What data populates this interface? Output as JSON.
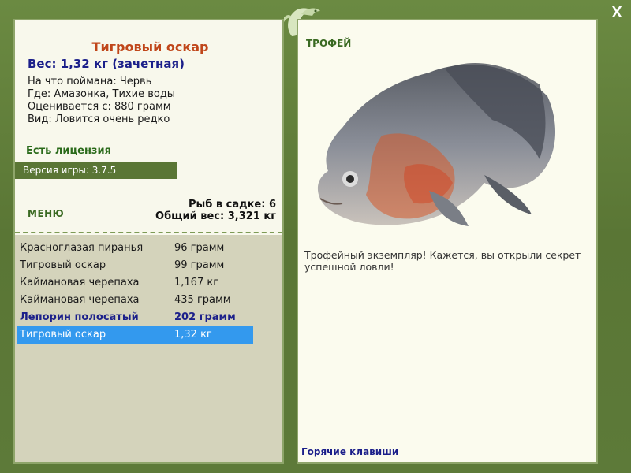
{
  "window": {
    "close_label": "X"
  },
  "fish": {
    "name": "Тигровый оскар",
    "weight": "Вес: 1,32 кг (зачетная)",
    "bait": "На что поймана: Червь",
    "location": "Где: Амазонка, Тихие воды",
    "value": "Оценивается с: 880 грамм",
    "rarity": "Вид: Ловится очень редко"
  },
  "license": "Есть лицензия",
  "version": "Версия игры: 3.7.5",
  "menu_label": "МЕНЮ",
  "cage": {
    "count": "Рыб в садке: 6",
    "total": "Общий вес: 3,321 кг"
  },
  "catch_list": [
    {
      "name": "Красноглазая пиранья",
      "weight": "96 грамм"
    },
    {
      "name": "Тигровый оскар",
      "weight": "99 грамм"
    },
    {
      "name": "Каймановая черепаха",
      "weight": "1,167 кг"
    },
    {
      "name": "Каймановая черепаха",
      "weight": "435 грамм"
    },
    {
      "name": "Лепорин полосатый",
      "weight": "202 грамм"
    },
    {
      "name": "Тигровый оскар",
      "weight": "1,32 кг"
    }
  ],
  "trophy_label": "ТРОФЕЙ",
  "trophy_text": "Трофейный экземпляр! Кажется, вы открыли секрет успешной ловли!",
  "hotkeys": "Горячие клавиши",
  "colors": {
    "frame": "#5e7a3a",
    "selected_row": "#3399ee",
    "title": "#c0461a",
    "highlight_text": "#1b1f8a"
  }
}
